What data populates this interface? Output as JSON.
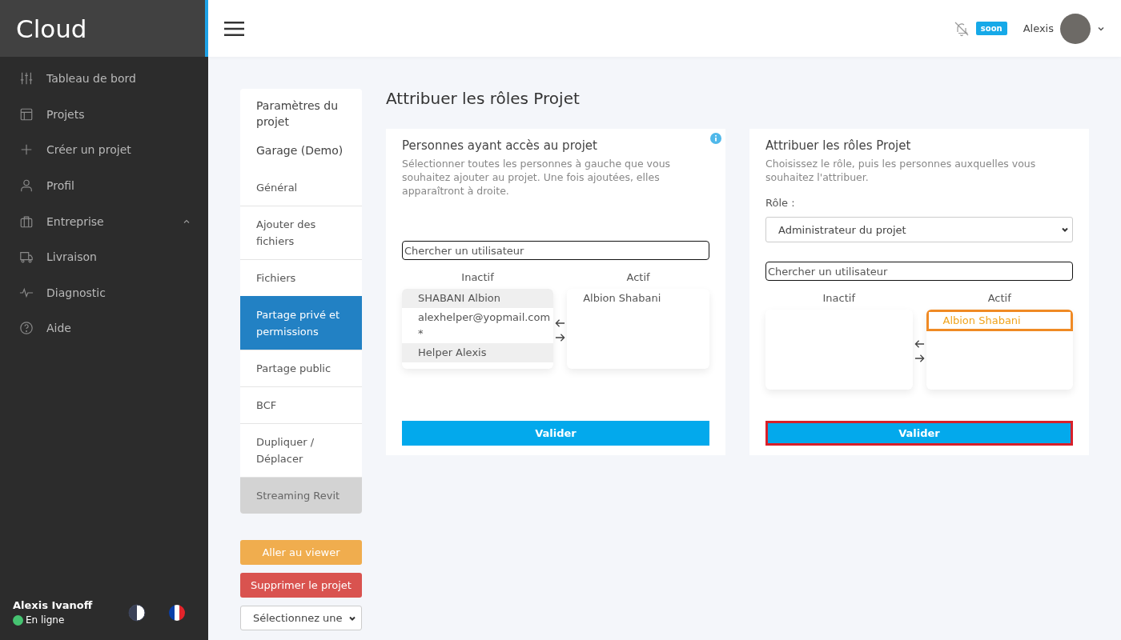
{
  "brand": "Cloud",
  "nav": [
    {
      "label": "Tableau de bord"
    },
    {
      "label": "Projets"
    },
    {
      "label": "Créer un projet"
    },
    {
      "label": "Profil"
    },
    {
      "label": "Entreprise",
      "expanded": true
    },
    {
      "label": "Livraison"
    },
    {
      "label": "Diagnostic"
    },
    {
      "label": "Aide"
    }
  ],
  "sidebar_user": {
    "name": "Alexis Ivanoff",
    "status": "En ligne",
    "online": true
  },
  "header": {
    "badge": "soon",
    "user_name": "Alexis"
  },
  "settings_menu": {
    "title": "Paramètres du projet",
    "project": "Garage (Demo)",
    "items": [
      {
        "label": "Général",
        "selected": false,
        "disabled": false
      },
      {
        "label": "Ajouter des fichiers",
        "selected": false,
        "disabled": false
      },
      {
        "label": "Fichiers",
        "selected": false,
        "disabled": false
      },
      {
        "label": "Partage privé et permissions",
        "selected": true,
        "disabled": false
      },
      {
        "label": "Partage public",
        "selected": false,
        "disabled": false
      },
      {
        "label": "BCF",
        "selected": false,
        "disabled": false
      },
      {
        "label": "Dupliquer / Déplacer",
        "selected": false,
        "disabled": false
      },
      {
        "label": "Streaming Revit",
        "selected": false,
        "disabled": true
      }
    ]
  },
  "actions": [
    {
      "label": "Aller au viewer",
      "kind": "warning"
    },
    {
      "label": "Supprimer le projet",
      "kind": "danger"
    }
  ],
  "action_select": {
    "value": "Sélectionnez une"
  },
  "page_title": "Attribuer les rôles Projet",
  "panels": [
    {
      "title": "Personnes ayant accès au projet",
      "description": "Sélectionner toutes les personnes à gauche que vous souhaitez ajouter au projet. Une fois ajoutées, elles apparaîtront à droite.",
      "info": true,
      "search_placeholder": "Chercher un utilisateur",
      "inactive_label": "Inactif",
      "active_label": "Actif",
      "inactive": [
        {
          "label": "SHABANI Albion",
          "selected": true
        },
        {
          "label": "alexhelper@yopmail.com *",
          "selected": false
        },
        {
          "label": "Helper Alexis",
          "selected": true
        }
      ],
      "active": [
        {
          "label": "Albion Shabani",
          "selected": false
        }
      ],
      "button": {
        "label": "Valider",
        "focused": false
      }
    },
    {
      "title": "Attribuer les rôles Projet",
      "description": "Choisissez le rôle, puis les personnes auxquelles vous souhaitez l'attribuer.",
      "info": false,
      "role_label": "Rôle :",
      "role_value": "Administrateur du projet",
      "search_placeholder": "Chercher un utilisateur",
      "inactive_label": "Inactif",
      "active_label": "Actif",
      "active": [
        {
          "label": "Albion Shabani",
          "selected": true
        }
      ],
      "button": {
        "label": "Valider",
        "focused": true
      }
    }
  ]
}
